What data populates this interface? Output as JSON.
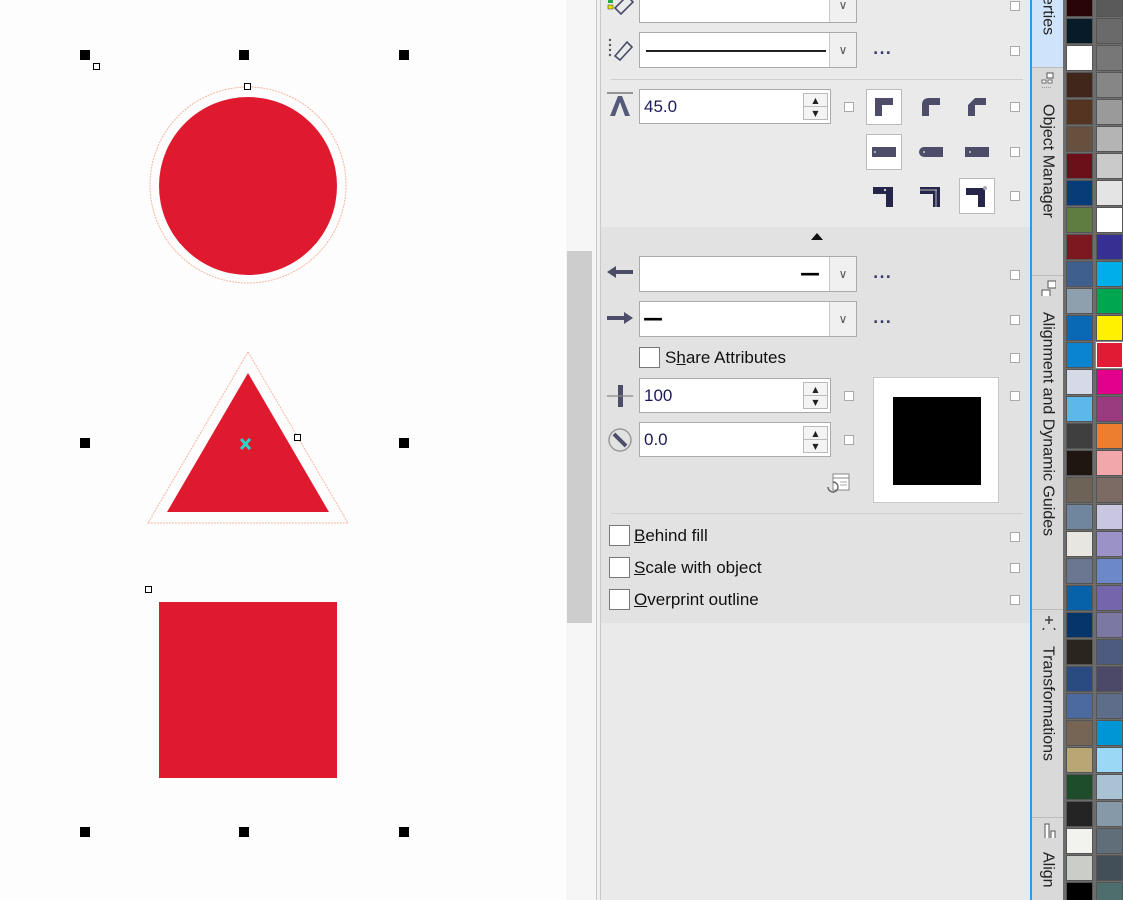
{
  "canvas": {
    "shapes": [
      {
        "type": "ellipse",
        "name": "red-circle",
        "fill": "#df1a2f"
      },
      {
        "type": "triangle",
        "name": "red-triangle",
        "fill": "#df1a2f"
      },
      {
        "type": "rectangle",
        "name": "red-square",
        "fill": "#df1a2f"
      }
    ],
    "outline_color": "#f5b5a0",
    "center_marker_color": "#2ed3c8"
  },
  "properties": {
    "pen_color_combo": {
      "value": ""
    },
    "line_style_combo": {
      "value": "solid"
    },
    "more_label": "...",
    "miter_limit": {
      "value": "45.0"
    },
    "corner_styles": [
      "miter",
      "round",
      "bevel"
    ],
    "line_caps": [
      "square",
      "round",
      "flat"
    ],
    "position_options": [
      "outside",
      "centered",
      "inside"
    ],
    "start_arrow": {
      "value": "—"
    },
    "end_arrow": {
      "value": "—"
    },
    "share_attributes": {
      "label_pre": "S",
      "label_ul": "h",
      "label_post": "are Attributes",
      "checked": false
    },
    "calligraphy_stretch": {
      "value": "100"
    },
    "calligraphy_angle": {
      "value": "0.0"
    },
    "nib_preview_color": "#000000",
    "behind_fill": {
      "label_ul": "B",
      "label_post": "ehind fill",
      "checked": false
    },
    "scale_with_object": {
      "label_ul": "S",
      "label_post": "cale with object",
      "checked": false
    },
    "overprint_outline": {
      "label_ul": "O",
      "label_post": "verprint outline",
      "checked": false
    }
  },
  "docker_tabs": [
    {
      "label": "erties",
      "icon": "properties-icon",
      "active": true
    },
    {
      "label": "Object Manager",
      "icon": "object-manager-icon",
      "active": false
    },
    {
      "label": "Alignment and Dynamic Guides",
      "icon": "alignment-guides-icon",
      "active": false
    },
    {
      "label": "Transformations",
      "icon": "transformations-icon",
      "active": false
    },
    {
      "label": "Align",
      "icon": "align-icon",
      "active": false
    }
  ],
  "palette": {
    "left_column": [
      "#2a0508",
      "#071c28",
      "#ffffff",
      "#41271b",
      "#553422",
      "#67503e",
      "#6b0f19",
      "#063c78",
      "#5f7c41",
      "#7c1820",
      "#3f5f8f",
      "#8ea0ad",
      "#0a69b4",
      "#0a84d0",
      "#d6dae8",
      "#5db8ea",
      "#3f3f3f",
      "#1f1612",
      "#6d6356",
      "#70869e",
      "#e8e6e0",
      "#6b7690",
      "#0762aa",
      "#06356c",
      "#2b2520",
      "#2a4a82",
      "#4d6a9e",
      "#766554",
      "#b8a674",
      "#1e4d2b",
      "#242424",
      "#f2f3ee",
      "#cbcec8",
      "#000000"
    ],
    "right_column": [
      "#5a5a5a",
      "#6a6a6a",
      "#777777",
      "#868686",
      "#9a9a9a",
      "#b4b4b4",
      "#cacaca",
      "#e4e4e4",
      "#ffffff",
      "#363092",
      "#00aee8",
      "#00a650",
      "#fff100",
      "#e01b33",
      "#e2008b",
      "#9a3b80",
      "#ee7e2f",
      "#f2a7ab",
      "#7c6b64",
      "#c9c6e2",
      "#9b92c8",
      "#6d88c8",
      "#7465ad",
      "#7b78a4",
      "#4d5b80",
      "#4b4868",
      "#5d6d8a",
      "#0096d6",
      "#9ad8f6",
      "#a9c3d5",
      "#8599a8",
      "#5f6e78",
      "#424e58",
      "#4e6e6e"
    ],
    "selected": "#e01b33"
  }
}
